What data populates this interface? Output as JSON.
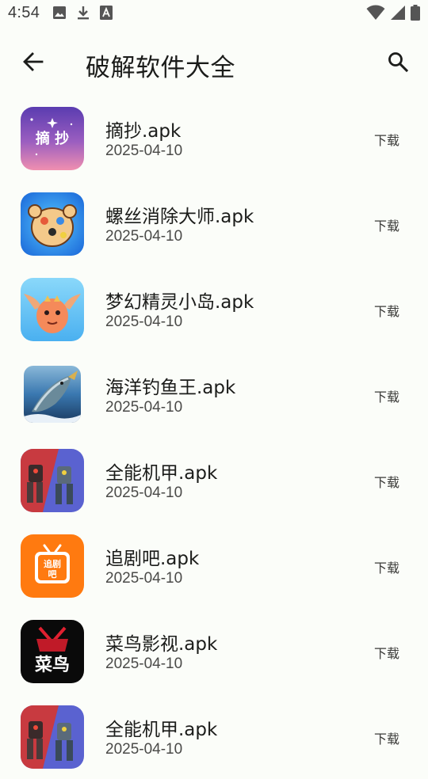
{
  "status_bar": {
    "time": "4:54",
    "left_icons": [
      "image-icon",
      "download-icon",
      "font-icon"
    ],
    "right_icons": [
      "wifi-icon",
      "signal-icon",
      "battery-icon"
    ]
  },
  "app_bar": {
    "title": "破解软件大全",
    "back_icon": "arrow-back-icon",
    "search_icon": "search-icon"
  },
  "items": [
    {
      "name": "摘抄.apk",
      "date": "2025-04-10",
      "action": "下载",
      "icon": "zhaichao-app-icon",
      "icon_text": "摘 抄",
      "icon_colors": [
        "#6b3fb7",
        "#e07aa8"
      ]
    },
    {
      "name": "螺丝消除大师.apk",
      "date": "2025-04-10",
      "action": "下载",
      "icon": "screw-master-app-icon",
      "icon_colors": [
        "#1a8de0",
        "#f3b36b"
      ]
    },
    {
      "name": "梦幻精灵小岛.apk",
      "date": "2025-04-10",
      "action": "下载",
      "icon": "fantasy-island-app-icon",
      "icon_colors": [
        "#6cc8f5",
        "#f0a070"
      ]
    },
    {
      "name": "海洋钓鱼王.apk",
      "date": "2025-04-10",
      "action": "下载",
      "icon": "fishing-king-app-icon",
      "icon_colors": [
        "#2a6fa8",
        "#d9b25a"
      ]
    },
    {
      "name": "全能机甲.apk",
      "date": "2025-04-10",
      "action": "下载",
      "icon": "mecha-app-icon",
      "icon_colors": [
        "#c8343c",
        "#5460c8"
      ]
    },
    {
      "name": "追剧吧.apk",
      "date": "2025-04-10",
      "action": "下载",
      "icon": "zhuiju-app-icon",
      "icon_text": "追剧吧",
      "icon_colors": [
        "#ff7a10",
        "#ffffff"
      ]
    },
    {
      "name": "菜鸟影视.apk",
      "date": "2025-04-10",
      "action": "下载",
      "icon": "cainiao-video-app-icon",
      "icon_text": "菜鸟",
      "icon_colors": [
        "#0a0a0a",
        "#e02030"
      ]
    },
    {
      "name": "全能机甲.apk",
      "date": "2025-04-10",
      "action": "下载",
      "icon": "mecha-app-icon",
      "icon_colors": [
        "#c8343c",
        "#5460c8"
      ]
    }
  ]
}
